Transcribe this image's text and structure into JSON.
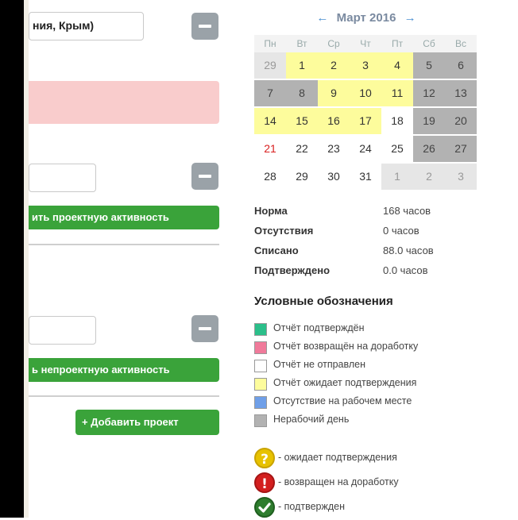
{
  "left": {
    "region_value": "ния, Крым)",
    "project_button_label": "ить проектную активность",
    "nonproject_button_label": "ь непроектную активность",
    "add_project_label": "+ Добавить проект"
  },
  "calendar": {
    "prev_arrow": "←",
    "next_arrow": "→",
    "title": "Март 2016",
    "weekdays": [
      "Пн",
      "Вт",
      "Ср",
      "Чт",
      "Пт",
      "Сб",
      "Вс"
    ],
    "weeks": [
      [
        {
          "d": "29",
          "s": "light"
        },
        {
          "d": "1",
          "s": "yellow"
        },
        {
          "d": "2",
          "s": "yellow"
        },
        {
          "d": "3",
          "s": "yellow"
        },
        {
          "d": "4",
          "s": "yellow"
        },
        {
          "d": "5",
          "s": "gray"
        },
        {
          "d": "6",
          "s": "gray"
        }
      ],
      [
        {
          "d": "7",
          "s": "gray"
        },
        {
          "d": "8",
          "s": "gray"
        },
        {
          "d": "9",
          "s": "yellow"
        },
        {
          "d": "10",
          "s": "yellow"
        },
        {
          "d": "11",
          "s": "yellow"
        },
        {
          "d": "12",
          "s": "gray"
        },
        {
          "d": "13",
          "s": "gray"
        }
      ],
      [
        {
          "d": "14",
          "s": "yellow"
        },
        {
          "d": "15",
          "s": "yellow"
        },
        {
          "d": "16",
          "s": "yellow"
        },
        {
          "d": "17",
          "s": "yellow"
        },
        {
          "d": "18",
          "s": "white"
        },
        {
          "d": "19",
          "s": "gray"
        },
        {
          "d": "20",
          "s": "gray"
        }
      ],
      [
        {
          "d": "21",
          "s": "red"
        },
        {
          "d": "22",
          "s": "white"
        },
        {
          "d": "23",
          "s": "white"
        },
        {
          "d": "24",
          "s": "white"
        },
        {
          "d": "25",
          "s": "white"
        },
        {
          "d": "26",
          "s": "gray"
        },
        {
          "d": "27",
          "s": "gray"
        }
      ],
      [
        {
          "d": "28",
          "s": "white"
        },
        {
          "d": "29",
          "s": "white"
        },
        {
          "d": "30",
          "s": "white"
        },
        {
          "d": "31",
          "s": "white"
        },
        {
          "d": "1",
          "s": "light"
        },
        {
          "d": "2",
          "s": "light"
        },
        {
          "d": "3",
          "s": "light"
        }
      ]
    ]
  },
  "stats": [
    {
      "label": "Норма",
      "value": "168 часов"
    },
    {
      "label": "Отсутствия",
      "value": "0 часов"
    },
    {
      "label": "Списано",
      "value": "88.0 часов"
    },
    {
      "label": "Подтверждено",
      "value": "0.0 часов"
    }
  ],
  "legend": {
    "title": "Условные обозначения",
    "items": [
      {
        "color": "#2bbf8a",
        "text": "Отчёт подтверждён"
      },
      {
        "color": "#f07a9a",
        "text": "Отчёт возвращён на доработку"
      },
      {
        "color": "#ffffff",
        "text": "Отчёт не отправлен"
      },
      {
        "color": "#fdfc9c",
        "text": "Отчёт ожидает подтверждения"
      },
      {
        "color": "#6f9fe8",
        "text": "Отсутствие на рабочем месте"
      },
      {
        "color": "#b2b2b2",
        "text": "Нерабочий день"
      }
    ]
  },
  "status_legend": [
    {
      "kind": "pending",
      "icon": "question-icon",
      "text": "- ожидает подтверждения"
    },
    {
      "kind": "returned",
      "icon": "exclamation-icon",
      "text": "- возвращен на доработку"
    },
    {
      "kind": "ok",
      "icon": "check-icon",
      "text": "- подтвержден"
    }
  ]
}
